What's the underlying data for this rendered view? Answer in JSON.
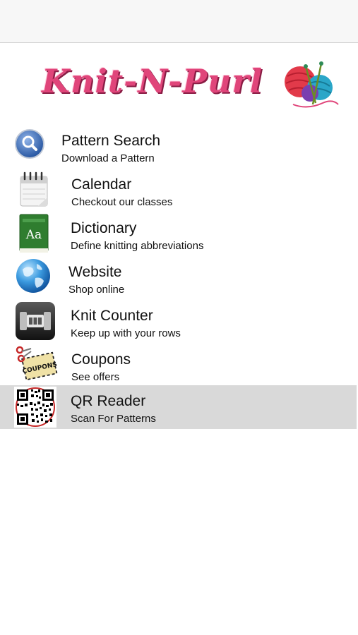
{
  "app": {
    "logo_text": "Knit-N-Purl"
  },
  "menu": {
    "items": [
      {
        "title": "Pattern Search",
        "subtitle": "Download a Pattern",
        "icon": "magnifier-icon"
      },
      {
        "title": "Calendar",
        "subtitle": "Checkout our classes",
        "icon": "calendar-icon"
      },
      {
        "title": "Dictionary",
        "subtitle": "Define knitting abbreviations",
        "icon": "dictionary-book-icon",
        "icon_text": "Aa"
      },
      {
        "title": "Website",
        "subtitle": "Shop online",
        "icon": "globe-icon"
      },
      {
        "title": "Knit Counter",
        "subtitle": "Keep up with your rows",
        "icon": "counter-icon"
      },
      {
        "title": "Coupons",
        "subtitle": "See offers",
        "icon": "coupon-scissors-icon",
        "icon_text": "COUPONS"
      },
      {
        "title": "QR Reader",
        "subtitle": "Scan For Patterns",
        "icon": "qr-code-icon",
        "selected": true
      }
    ]
  },
  "colors": {
    "navbar_bg": "#f7f7f7",
    "selected_row_bg": "#d9d9d9",
    "logo_pink": "#e0457a"
  }
}
